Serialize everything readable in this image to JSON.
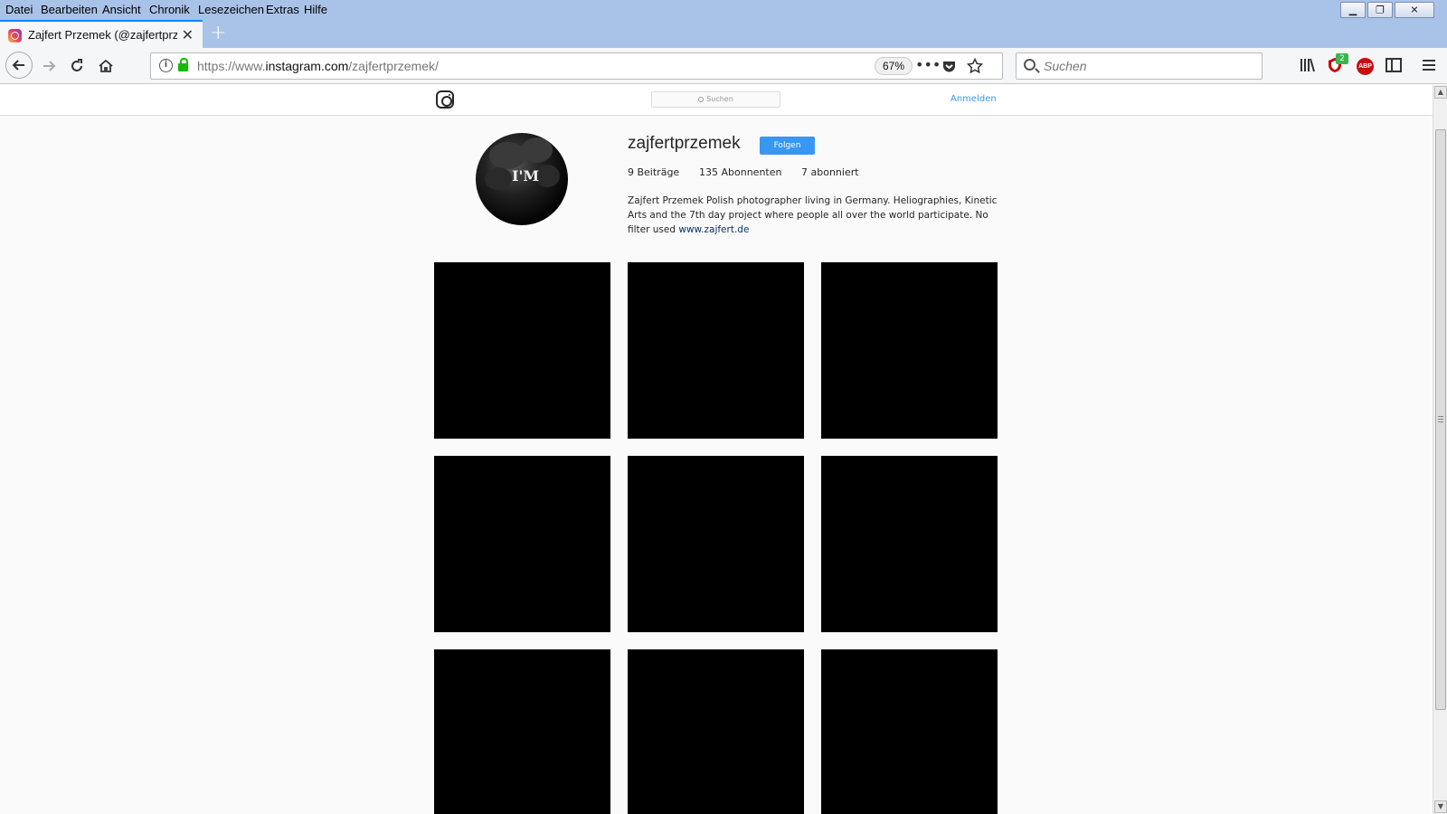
{
  "menu": [
    "Datei",
    "Bearbeiten",
    "Ansicht",
    "Chronik",
    "Lesezeichen",
    "Extras",
    "Hilfe"
  ],
  "tab": {
    "title": "Zajfert Przemek (@zajfertprzem",
    "close": "✕"
  },
  "newtab": "+",
  "url": {
    "scheme": "https://www.",
    "host": "instagram.com",
    "path": "/zajfertprzemek/",
    "zoom": "67%"
  },
  "search": {
    "placeholder": "Suchen"
  },
  "toolbar": {
    "ublock_badge": "2",
    "abp_label": "ABP"
  },
  "icons": {
    "back": "back-arrow-icon",
    "forward": "forward-arrow-icon",
    "reload": "reload-icon",
    "home": "home-icon",
    "page_actions": "more-dots-icon",
    "pocket": "pocket-icon",
    "bookmark": "star-icon",
    "library": "library-icon",
    "sidebar": "sidebar-icon",
    "menu": "hamburger-icon"
  },
  "ig": {
    "search_label": "Suchen",
    "login": "Anmelden",
    "username": "zajfertprzemek",
    "follow": "Folgen",
    "stats": {
      "posts": "9 Beiträge",
      "followers": "135 Abonnenten",
      "following": "7 abonniert"
    },
    "bio_text": "Zajfert Przemek Polish photographer living in Germany. Heliographies, Kinetic Arts and the 7th day project where people all over the world participate. No filter used",
    "bio_link": "www.zajfert.de",
    "avatar_text": "I'M",
    "post_count_visible": 9
  }
}
